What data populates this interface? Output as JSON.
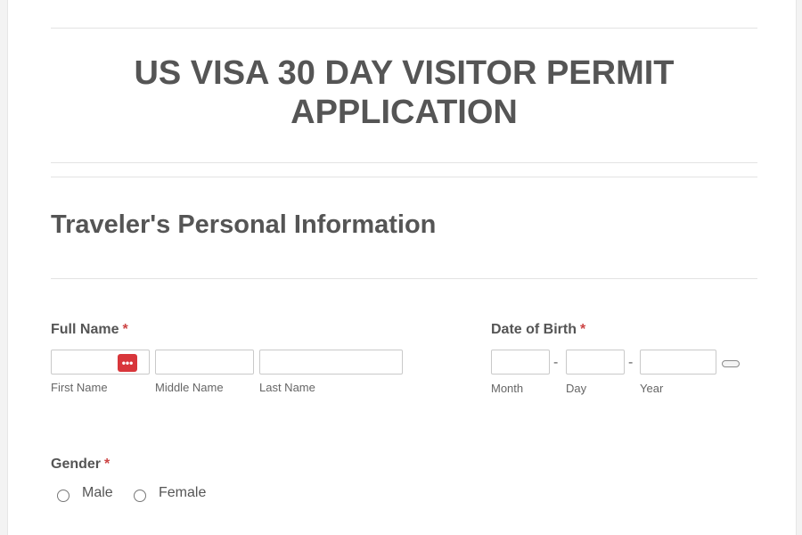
{
  "form": {
    "title_line1": "US VISA 30 DAY VISITOR PERMIT",
    "title_line2": "APPLICATION"
  },
  "section": {
    "title": "Traveler's Personal Information"
  },
  "full_name": {
    "label": "Full Name",
    "required": "*",
    "first": {
      "value": "",
      "sublabel": "First Name"
    },
    "middle": {
      "value": "",
      "sublabel": "Middle Name"
    },
    "last": {
      "value": "",
      "sublabel": "Last Name"
    },
    "password_manager_icon": "•••"
  },
  "dob": {
    "label": "Date of Birth",
    "required": "*",
    "month": {
      "value": "",
      "sublabel": "Month"
    },
    "day": {
      "value": "",
      "sublabel": "Day"
    },
    "year": {
      "value": "",
      "sublabel": "Year"
    },
    "separator": "-",
    "icon": "calendar-icon"
  },
  "gender": {
    "label": "Gender",
    "required": "*",
    "options": [
      {
        "label": "Male",
        "checked": false
      },
      {
        "label": "Female",
        "checked": false
      }
    ]
  }
}
